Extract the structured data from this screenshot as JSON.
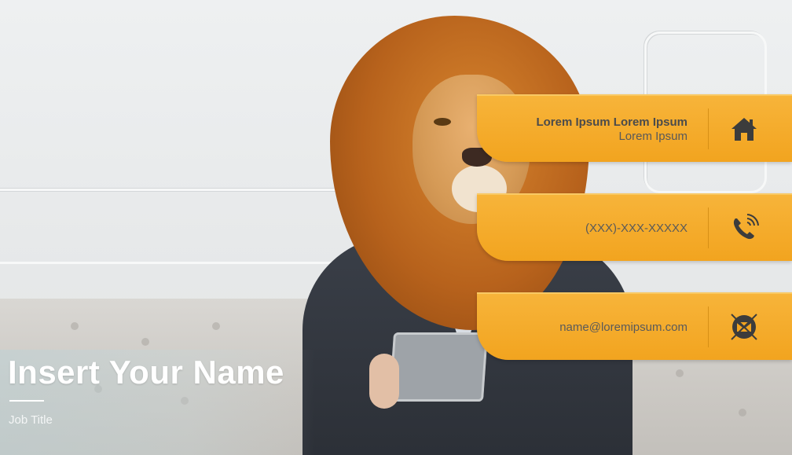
{
  "profile": {
    "name": "Insert Your Name",
    "job_title": "Job Title"
  },
  "contacts": {
    "address": {
      "line1": "Lorem Ipsum Lorem Ipsum",
      "line2": "Lorem Ipsum",
      "icon": "home-icon"
    },
    "phone": {
      "value": "(XXX)-XXX-XXXXX",
      "icon": "phone-icon"
    },
    "email": {
      "value": "name@loremipsum.com",
      "icon": "mail-icon"
    }
  },
  "colors": {
    "accent": "#f2a41f",
    "icon": "#3c3c3c",
    "text": "#595959"
  }
}
